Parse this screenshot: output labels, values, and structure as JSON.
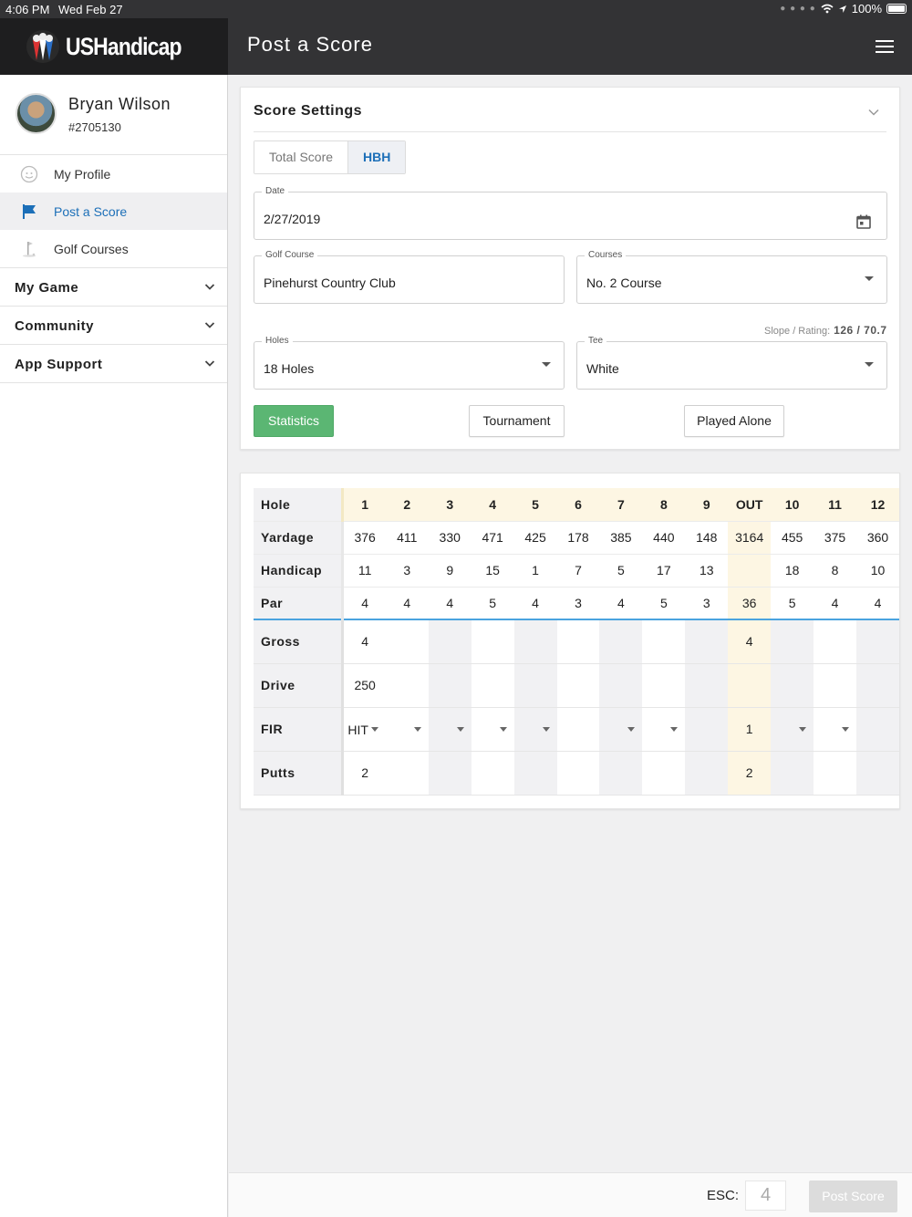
{
  "status_bar": {
    "time": "4:06 PM",
    "date": "Wed Feb 27",
    "battery": "100%"
  },
  "header": {
    "logo_text": "USHandicap",
    "title": "Post a Score"
  },
  "sidebar": {
    "user_name": "Bryan Wilson",
    "user_id": "#2705130",
    "items": [
      {
        "label": "My Profile",
        "icon": "profile-icon"
      },
      {
        "label": "Post a Score",
        "icon": "flag-icon"
      },
      {
        "label": "Golf Courses",
        "icon": "golf-pin-icon"
      }
    ],
    "sections": [
      {
        "label": "My Game"
      },
      {
        "label": "Community"
      },
      {
        "label": "App Support"
      }
    ],
    "active_color": "#1c6fb8"
  },
  "settings": {
    "title": "Score Settings",
    "tabs": {
      "total": "Total Score",
      "hbh": "HBH"
    },
    "date": {
      "label": "Date",
      "value": "2/27/2019"
    },
    "golf_course": {
      "label": "Golf Course",
      "value": "Pinehurst Country Club"
    },
    "courses": {
      "label": "Courses",
      "value": "No. 2 Course"
    },
    "slope_label": "Slope / Rating:",
    "slope_value": "126  /  70.7",
    "holes": {
      "label": "Holes",
      "value": "18 Holes"
    },
    "tee": {
      "label": "Tee",
      "value": "White"
    },
    "buttons": {
      "statistics": "Statistics",
      "tournament": "Tournament",
      "played_alone": "Played Alone"
    },
    "statistics_color": "#5bb673"
  },
  "scorecard": {
    "row_labels": {
      "hole": "Hole",
      "yardage": "Yardage",
      "handicap": "Handicap",
      "par": "Par",
      "gross": "Gross",
      "drive": "Drive",
      "fir": "FIR",
      "putts": "Putts"
    },
    "columns": [
      "1",
      "2",
      "3",
      "4",
      "5",
      "6",
      "7",
      "8",
      "9",
      "OUT",
      "10",
      "11",
      "12"
    ],
    "yardage": [
      "376",
      "411",
      "330",
      "471",
      "425",
      "178",
      "385",
      "440",
      "148",
      "3164",
      "455",
      "375",
      "360"
    ],
    "handicap": [
      "11",
      "3",
      "9",
      "15",
      "1",
      "7",
      "5",
      "17",
      "13",
      "",
      "18",
      "8",
      "10"
    ],
    "par": [
      "4",
      "4",
      "4",
      "5",
      "4",
      "3",
      "4",
      "5",
      "3",
      "36",
      "5",
      "4",
      "4"
    ],
    "gross": [
      "4",
      "",
      "",
      "",
      "",
      "",
      "",
      "",
      "",
      "4",
      "",
      "",
      ""
    ],
    "drive": [
      "250",
      "",
      "",
      "",
      "",
      "",
      "",
      "",
      "",
      "",
      "",
      "",
      ""
    ],
    "fir": [
      "HIT",
      "",
      "",
      "",
      "",
      "",
      "",
      "",
      "",
      "1",
      "",
      "",
      ""
    ],
    "putts": [
      "2",
      "",
      "",
      "",
      "",
      "",
      "",
      "",
      "",
      "2",
      "",
      "",
      ""
    ]
  },
  "footer": {
    "esc_label": "ESC:",
    "esc_value": "4",
    "post_button": "Post Score"
  }
}
